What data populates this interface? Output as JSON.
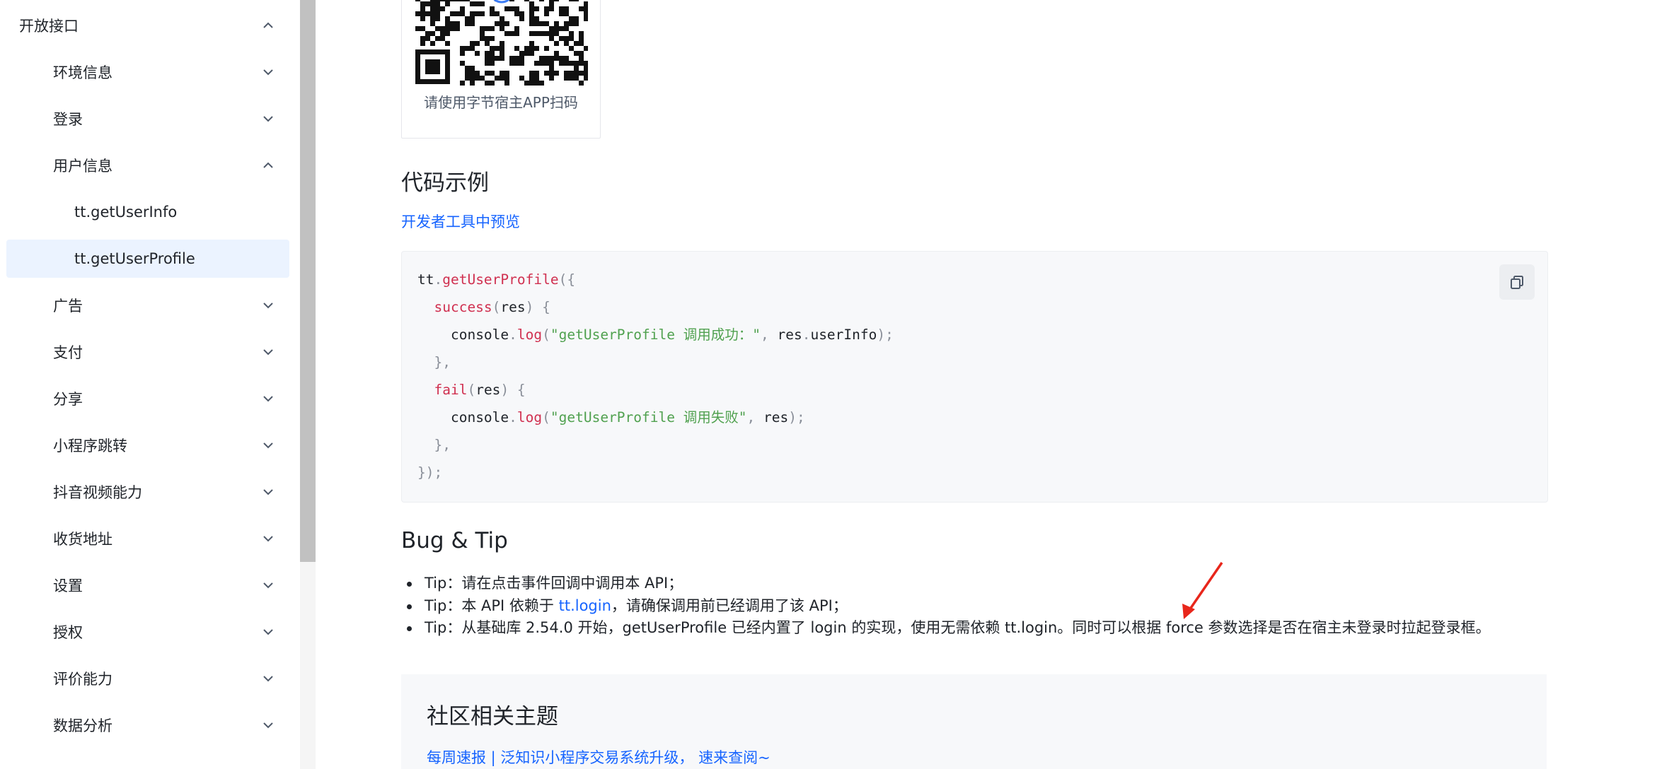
{
  "sidebar": {
    "items": [
      {
        "label": "开放接口",
        "expanded": true
      },
      {
        "label": "环境信息",
        "expanded": false
      },
      {
        "label": "登录",
        "expanded": false
      },
      {
        "label": "用户信息",
        "expanded": true
      },
      {
        "label": "tt.getUserInfo"
      },
      {
        "label": "tt.getUserProfile",
        "active": true
      },
      {
        "label": "广告",
        "expanded": false
      },
      {
        "label": "支付",
        "expanded": false
      },
      {
        "label": "分享",
        "expanded": false
      },
      {
        "label": "小程序跳转",
        "expanded": false
      },
      {
        "label": "抖音视频能力",
        "expanded": false
      },
      {
        "label": "收货地址",
        "expanded": false
      },
      {
        "label": "设置",
        "expanded": false
      },
      {
        "label": "授权",
        "expanded": false
      },
      {
        "label": "评价能力",
        "expanded": false
      },
      {
        "label": "数据分析",
        "expanded": false
      }
    ]
  },
  "qr": {
    "caption": "请使用字节宿主APP扫码"
  },
  "code_section": {
    "title": "代码示例",
    "preview_link": "开发者工具中预览",
    "code": {
      "l1_obj": "tt",
      "l1_fn": "getUserProfile",
      "l1_open": "({",
      "l2_key": "success",
      "l2_arg": "res",
      "l3_obj": "console",
      "l3_fn": "log",
      "l3_str": "\"getUserProfile 调用成功：\"",
      "l3_obj2": "res",
      "l3_prop": "userInfo",
      "l5_key": "fail",
      "l5_arg": "res",
      "l6_obj": "console",
      "l6_fn": "log",
      "l6_str": "\"getUserProfile 调用失败\"",
      "l6_arg2": "res"
    },
    "copy_icon": "copy-icon"
  },
  "bug_tip": {
    "title": "Bug & Tip",
    "tip1": "Tip：请在点击事件回调中调用本 API；",
    "tip2_prefix": "Tip：本 API 依赖于 ",
    "tip2_link": "tt.login",
    "tip2_suffix": "，请确保调用前已经调用了该 API；",
    "tip3": "Tip：从基础库 2.54.0 开始，getUserProfile 已经内置了 login 的实现，使用无需依赖 tt.login。同时可以根据 force 参数选择是否在宿主未登录时拉起登录框。"
  },
  "community": {
    "title": "社区相关主题",
    "link": "每周速报 | 泛知识小程序交易系统升级， 速来查阅~"
  },
  "colors": {
    "link": "#1664ff",
    "active_bg": "#ebf3ff",
    "code_bg": "#f7f8fa",
    "arrow": "#e8261b"
  }
}
